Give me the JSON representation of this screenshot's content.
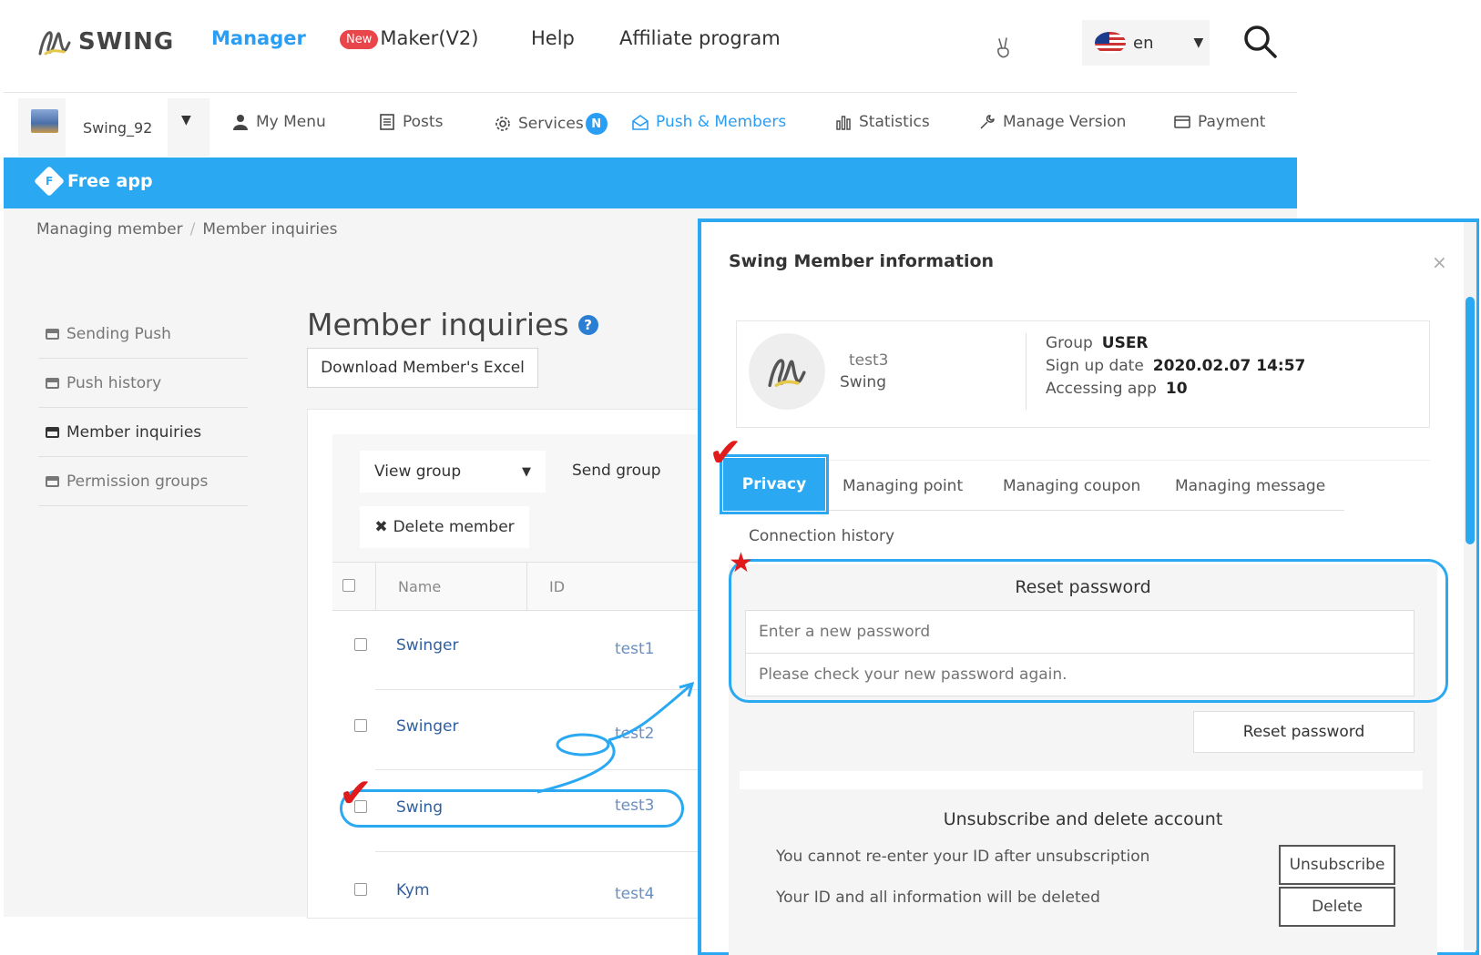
{
  "header": {
    "logo_text": "SWING",
    "nav": {
      "manager": "Manager",
      "new_badge": "New",
      "maker": "Maker(V2)",
      "help": "Help",
      "affiliate": "Affiliate program"
    },
    "language": "en"
  },
  "subnav": {
    "app_name": "Swing_92",
    "items": {
      "my_menu": "My Menu",
      "posts": "Posts",
      "services": "Services",
      "services_badge": "N",
      "push_members": "Push & Members",
      "statistics": "Statistics",
      "manage_version": "Manage Version",
      "payment": "Payment"
    }
  },
  "banner": {
    "badge": "F",
    "label": "Free app"
  },
  "breadcrumb": {
    "parent": "Managing member",
    "separator": "/",
    "current": "Member inquiries"
  },
  "sidebar": {
    "items": [
      "Sending Push",
      "Push history",
      "Member inquiries",
      "Permission groups"
    ]
  },
  "main": {
    "title": "Member inquiries",
    "help_glyph": "?",
    "excel_button": "Download Member's Excel",
    "view_group": "View group",
    "send_group": "Send group",
    "delete_member": "Delete member",
    "columns": {
      "name": "Name",
      "id": "ID"
    },
    "rows": [
      {
        "name": "Swinger",
        "id": "test1"
      },
      {
        "name": "Swinger",
        "id": "test2"
      },
      {
        "name": "Swing",
        "id": "test3"
      },
      {
        "name": "Kym",
        "id": "test4"
      }
    ]
  },
  "modal": {
    "title": "Swing Member information",
    "close": "×",
    "profile": {
      "id": "test3",
      "name": "Swing",
      "group_label": "Group",
      "group_value": "USER",
      "signup_label": "Sign up date",
      "signup_value": "2020.02.07 14:57",
      "access_label": "Accessing app",
      "access_value": "10"
    },
    "tabs": [
      "Privacy",
      "Managing point",
      "Managing coupon",
      "Managing message",
      "Connection history"
    ],
    "reset": {
      "title": "Reset password",
      "new_placeholder": "Enter a new password",
      "confirm_placeholder": "Please check your new password again.",
      "button": "Reset password"
    },
    "unsubscribe": {
      "title": "Unsubscribe and delete account",
      "line1": "You cannot re-enter your ID after unsubscription",
      "line2": "Your ID and all information will be deleted",
      "unsub_button": "Unsubscribe",
      "delete_button": "Delete"
    }
  },
  "colors": {
    "accent": "#2aa8f2",
    "link": "#2f5fa0",
    "annotation_red": "#e01b1b"
  }
}
